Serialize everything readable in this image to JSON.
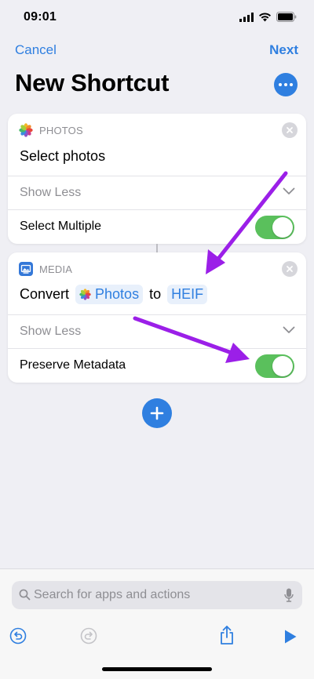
{
  "status": {
    "time": "09:01"
  },
  "nav": {
    "cancel_label": "Cancel",
    "next_label": "Next"
  },
  "page": {
    "title": "New Shortcut"
  },
  "actions": [
    {
      "category": "PHOTOS",
      "title": "Select photos",
      "show_less_label": "Show Less",
      "option_label": "Select Multiple",
      "option_enabled": true,
      "icon": "photos-app-icon"
    },
    {
      "category": "MEDIA",
      "title_prefix": "Convert",
      "input_token": "Photos",
      "connector_word": "to",
      "format_token": "HEIF",
      "show_less_label": "Show Less",
      "option_label": "Preserve Metadata",
      "option_enabled": true,
      "icon": "media-icon"
    }
  ],
  "search": {
    "placeholder": "Search for apps and actions"
  },
  "colors": {
    "accent": "#2f7fe0",
    "toggle_on": "#5ac05c",
    "annotation_arrow": "#9b1fe8"
  }
}
